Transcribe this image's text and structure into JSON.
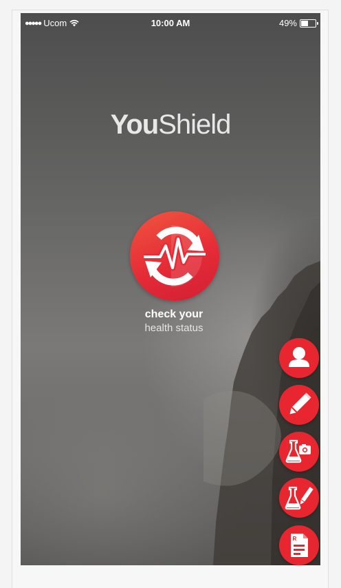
{
  "status_bar": {
    "signal": "●●●●●",
    "carrier": "Ucom",
    "time": "10:00 AM",
    "battery": "49%",
    "battery_level": 0.49
  },
  "brand": {
    "bold": "You",
    "thin": "Shield"
  },
  "check_button": {
    "icon": "health-sync-icon"
  },
  "cta": {
    "line1": "check your",
    "line2": "health status"
  },
  "fab_icons": [
    "user-icon",
    "pencil-icon",
    "flask-camera-icon",
    "flask-pencil-icon",
    "prescription-icon"
  ],
  "colors": {
    "accent": "#e8262f",
    "logo_gradient_start": "#f0553f",
    "logo_gradient_end": "#d21f33",
    "text": "#ffffff"
  }
}
